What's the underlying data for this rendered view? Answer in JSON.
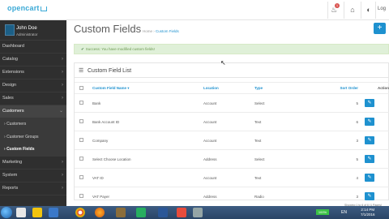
{
  "app": {
    "logo": "opencart"
  },
  "header": {
    "notification_count": "1",
    "logout_label": "Log"
  },
  "sidebar": {
    "user_name": "John Doe",
    "user_role": "Administrator",
    "items": [
      {
        "label": "Dashboard"
      },
      {
        "label": "Catalog"
      },
      {
        "label": "Extensions"
      },
      {
        "label": "Design"
      },
      {
        "label": "Sales"
      },
      {
        "label": "Customers"
      },
      {
        "label": "Marketing"
      },
      {
        "label": "System"
      },
      {
        "label": "Reports"
      }
    ],
    "sub_items": [
      {
        "label": "Customers"
      },
      {
        "label": "Customer Groups"
      },
      {
        "label": "Custom Fields"
      }
    ]
  },
  "page": {
    "title": "Custom Fields",
    "breadcrumb_home": "Home",
    "breadcrumb_current": "Custom Fields",
    "add_label": "+"
  },
  "alert": {
    "text": "Success: You have modified custom fields!"
  },
  "panel": {
    "title": "Custom Field List"
  },
  "table": {
    "headers": {
      "name": "Custom Field Name",
      "location": "Location",
      "type": "Type",
      "sort": "Sort Order",
      "action": "Action"
    },
    "rows": [
      {
        "name": "Bank",
        "location": "Account",
        "type": "Select",
        "sort": "5"
      },
      {
        "name": "Bank Account ID",
        "location": "Account",
        "type": "Text",
        "sort": "6"
      },
      {
        "name": "Company",
        "location": "Account",
        "type": "Text",
        "sort": "3"
      },
      {
        "name": "Select Choose Location",
        "location": "Address",
        "type": "Select",
        "sort": "5"
      },
      {
        "name": "VAT ID",
        "location": "Account",
        "type": "Text",
        "sort": "4"
      },
      {
        "name": "VAT Payer",
        "location": "Address",
        "type": "Radio",
        "sort": "3"
      }
    ]
  },
  "pagination": {
    "text": "Showing 1 to 6 of 6 (1 Pages)"
  },
  "taskbar": {
    "battery": "100%",
    "language": "EN",
    "time": "2:14 PM",
    "date": "7/1/2016"
  },
  "colors": {
    "accent": "#1e91cf",
    "sidebar_bg": "#2f2f2f",
    "alert_bg": "#dff0d8"
  }
}
